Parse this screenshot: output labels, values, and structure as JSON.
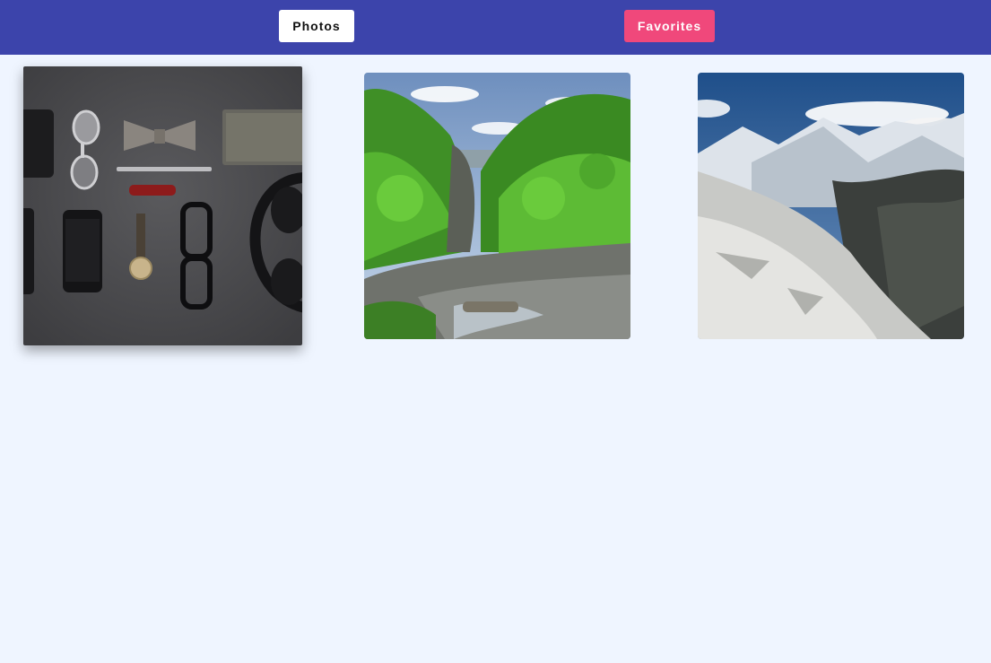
{
  "nav": {
    "photos_label": "Photos",
    "favorites_label": "Favorites"
  },
  "photos": [
    {
      "subject": "flat-lay accessories on grey background"
    },
    {
      "subject": "green forest with rocky stream"
    },
    {
      "subject": "snowy mountain range"
    }
  ],
  "colors": {
    "header": "#3c44ab",
    "background": "#eff5ff",
    "favorites_button": "#f0487b",
    "photos_button": "#ffffff"
  }
}
